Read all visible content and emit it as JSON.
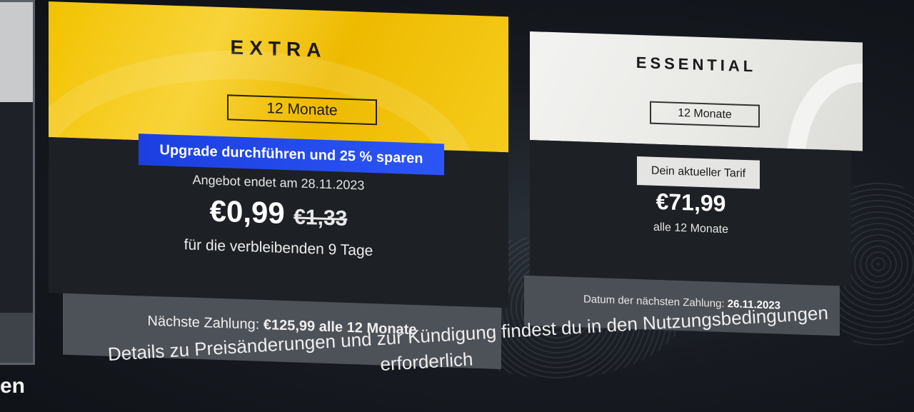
{
  "left_card": {
    "partial_word": "en"
  },
  "extra": {
    "title": "EXTRA",
    "period": "12 Monate",
    "upgrade_banner": "Upgrade durchführen und 25 % sparen",
    "offer_end": "Angebot endet am 28.11.2023",
    "price_new": "€0,99",
    "price_old": "€1,33",
    "remaining": "für die verbleibenden 9 Tage",
    "next_payment_label": "Nächste Zahlung:",
    "next_payment_value": "€125,99 alle 12 Monate"
  },
  "essential": {
    "title": "ESSENTIAL",
    "period": "12 Monate",
    "current_badge": "Dein aktueller Tarif",
    "price": "€71,99",
    "per": "alle 12 Monate",
    "next_payment_label": "Datum der nächsten Zahlung:",
    "next_payment_value": "26.11.2023"
  },
  "footer_text": {
    "line1": "Details zu Preisänderungen und zur Kündigung findest du in den Nutzungsbedingungen",
    "line2": "erforderlich"
  },
  "colors": {
    "extra_gold": "#f2c200",
    "banner_blue": "#1b3fe0",
    "card_dark": "#1d2025",
    "footer_gray": "#4d5158"
  }
}
